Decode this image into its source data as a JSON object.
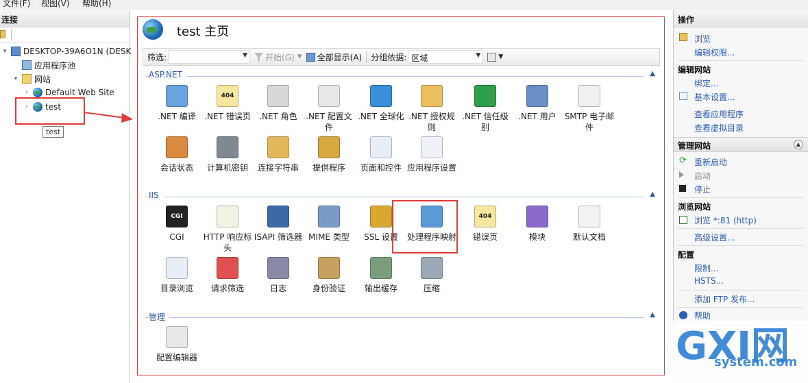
{
  "menu": {
    "file": "文件(F)",
    "view": "视图(V)",
    "help": "帮助(H)"
  },
  "connections": {
    "title": "连接",
    "tree": {
      "server": "DESKTOP-39A6O1N (DESK",
      "app_pools": "应用程序池",
      "sites": "网站",
      "default_site": "Default Web Site",
      "test_site": "test"
    },
    "tooltip": "test"
  },
  "main": {
    "title": "test 主页",
    "filter": {
      "label": "筛选:",
      "start": "开始(G)",
      "show_all": "全部显示(A)",
      "group_label": "分组依据:",
      "group_value": "区域"
    },
    "sections": {
      "aspnet": "ASP.NET",
      "iis": "IIS",
      "manage": "管理"
    },
    "features": {
      "aspnet": [
        ".NET 编译",
        ".NET 错误页",
        ".NET 角色",
        ".NET 配置文件",
        ".NET 全球化",
        ".NET 授权规则",
        ".NET 信任级别",
        ".NET 用户",
        "SMTP 电子邮件",
        "会话状态",
        "计算机密钥",
        "连接字符串",
        "提供程序",
        "页面和控件",
        "应用程序设置"
      ],
      "iis": [
        "CGI",
        "HTTP 响应标头",
        "ISAPI 筛选器",
        "MIME 类型",
        "SSL 设置",
        "处理程序映射",
        "错误页",
        "模块",
        "默认文档",
        "目录浏览",
        "请求筛选",
        "日志",
        "身份验证",
        "输出缓存",
        "压缩"
      ],
      "manage": [
        "配置编辑器"
      ]
    },
    "icon_text": {
      "cgi": "CGI",
      "e404": "404"
    }
  },
  "actions": {
    "title": "操作",
    "browse": "浏览",
    "edit_permissions": "编辑权限...",
    "edit_site": "编辑网站",
    "bindings": "绑定...",
    "basic_settings": "基本设置...",
    "view_apps": "查看应用程序",
    "view_vdirs": "查看虚拟目录",
    "manage_site": "管理网站",
    "restart": "重新启动",
    "start": "启动",
    "stop": "停止",
    "browse_site": "浏览网站",
    "browse_81": "浏览 *:81 (http)",
    "advanced": "高级设置...",
    "config": "配置",
    "limits": "限制...",
    "hsts": "HSTS...",
    "add_ftp": "添加 FTP 发布...",
    "help": "帮助"
  },
  "watermark": {
    "brand": "GXI网",
    "domain": "system.com"
  },
  "colors": {
    "accent": "#2a5db0",
    "highlight": "#e23b3b"
  }
}
